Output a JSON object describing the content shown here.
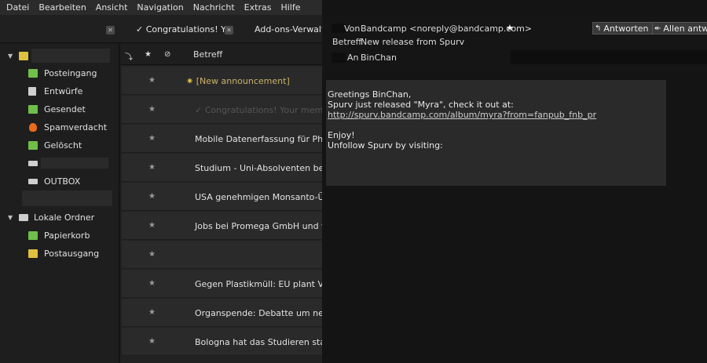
{
  "menu": [
    "Datei",
    "Bearbeiten",
    "Ansicht",
    "Navigation",
    "Nachricht",
    "Extras",
    "Hilfe"
  ],
  "tabs": [
    {
      "label": "✓ Congratulations! Y..."
    },
    {
      "label": "Add-ons-Verwaltung"
    }
  ],
  "folders": {
    "account_label": "",
    "items": [
      {
        "label": "Posteingang",
        "icon": "inbox-icon",
        "color": "#6fbf4a"
      },
      {
        "label": "Entwürfe",
        "icon": "drafts-icon",
        "color": "#d0d0d0"
      },
      {
        "label": "Gesendet",
        "icon": "sent-icon",
        "color": "#6fbf4a"
      },
      {
        "label": "Spamverdacht",
        "icon": "junk-flame-icon",
        "color": "#e86a1a"
      },
      {
        "label": "Gelöscht",
        "icon": "trash-icon",
        "color": "#6fbf4a"
      },
      {
        "label": "",
        "icon": "folder-icon",
        "color": "#cfcfcf"
      },
      {
        "label": "OUTBOX",
        "icon": "folder-icon",
        "color": "#cfcfcf"
      }
    ],
    "local_label": "Lokale Ordner",
    "local_items": [
      {
        "label": "Papierkorb",
        "icon": "trash-icon",
        "color": "#6fbf4a"
      },
      {
        "label": "Postausgang",
        "icon": "outbox-icon",
        "color": "#e0c040"
      }
    ]
  },
  "list": {
    "column_subject": "Betreff",
    "rows": [
      {
        "subject": "[New announcement]",
        "style": "link",
        "prefix": "✷ "
      },
      {
        "subject": "✓ Congratulations! Your membership",
        "style": "muted",
        "prefix": ""
      },
      {
        "subject": "Mobile Datenerfassung für Pharma",
        "style": "",
        "prefix": ""
      },
      {
        "subject": "Studium - Uni-Absolventen bekommen",
        "style": "",
        "prefix": ""
      },
      {
        "subject": "USA genehmigen Monsanto-Übernahme",
        "style": "",
        "prefix": ""
      },
      {
        "subject": "Jobs bei Promega GmbH und vielen",
        "style": "",
        "prefix": ""
      },
      {
        "subject": "",
        "style": "",
        "prefix": ""
      },
      {
        "subject": "Gegen Plastikmüll: EU plant Verbot",
        "style": "",
        "prefix": ""
      },
      {
        "subject": "Organspende: Debatte um neue Regeln",
        "style": "",
        "prefix": ""
      },
      {
        "subject": "Bologna hat das Studieren stark verändert",
        "style": "",
        "prefix": ""
      }
    ]
  },
  "message": {
    "from_label": "Von",
    "from_value": "Bandcamp <noreply@bandcamp.com>",
    "subject_label": "Betreff",
    "subject_value": "New release from Spurv",
    "to_label": "An",
    "to_value": "BinChan",
    "reply_label": "Antworten",
    "reply_all_label": "Allen antw",
    "body": {
      "greeting": "Greetings BinChan,",
      "line1": "Spurv just released \"Myra\", check it out at:",
      "link": "http://spurv.bandcamp.com/album/myra?from=fanpub_fnb_pr",
      "enjoy": "Enjoy!",
      "unfollow": "Unfollow Spurv by visiting:"
    }
  }
}
